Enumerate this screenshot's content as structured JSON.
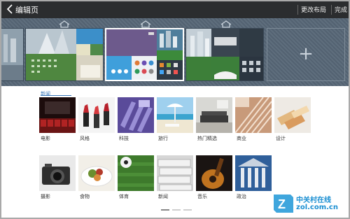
{
  "header": {
    "title": "编辑页",
    "change_layout": "更改布局",
    "done": "完成"
  },
  "panel": {
    "add_symbol": "+"
  },
  "section": {
    "title": "新闻"
  },
  "categories": [
    {
      "label": "电影",
      "icon": "cinema-seats-image"
    },
    {
      "label": "风格",
      "icon": "lipsticks-image"
    },
    {
      "label": "科技",
      "icon": "tech-grid-image"
    },
    {
      "label": "旅行",
      "icon": "beach-image"
    },
    {
      "label": "热门精选",
      "icon": "living-room-image"
    },
    {
      "label": "商业",
      "icon": "building-image"
    },
    {
      "label": "设计",
      "icon": "design-swatches-image"
    },
    {
      "label": "摄影",
      "icon": "camera-image"
    },
    {
      "label": "食物",
      "icon": "food-plate-image"
    },
    {
      "label": "体育",
      "icon": "soccer-field-image"
    },
    {
      "label": "新闻",
      "icon": "newspapers-image"
    },
    {
      "label": "音乐",
      "icon": "guitar-image"
    },
    {
      "label": "政治",
      "icon": "columns-image"
    }
  ],
  "watermark": {
    "brand": "中关村在线",
    "site": "zol.com.cn"
  },
  "colors": {
    "topbar": "#2b2d2f",
    "panel": "#566676",
    "accent": "#3b78b9"
  }
}
